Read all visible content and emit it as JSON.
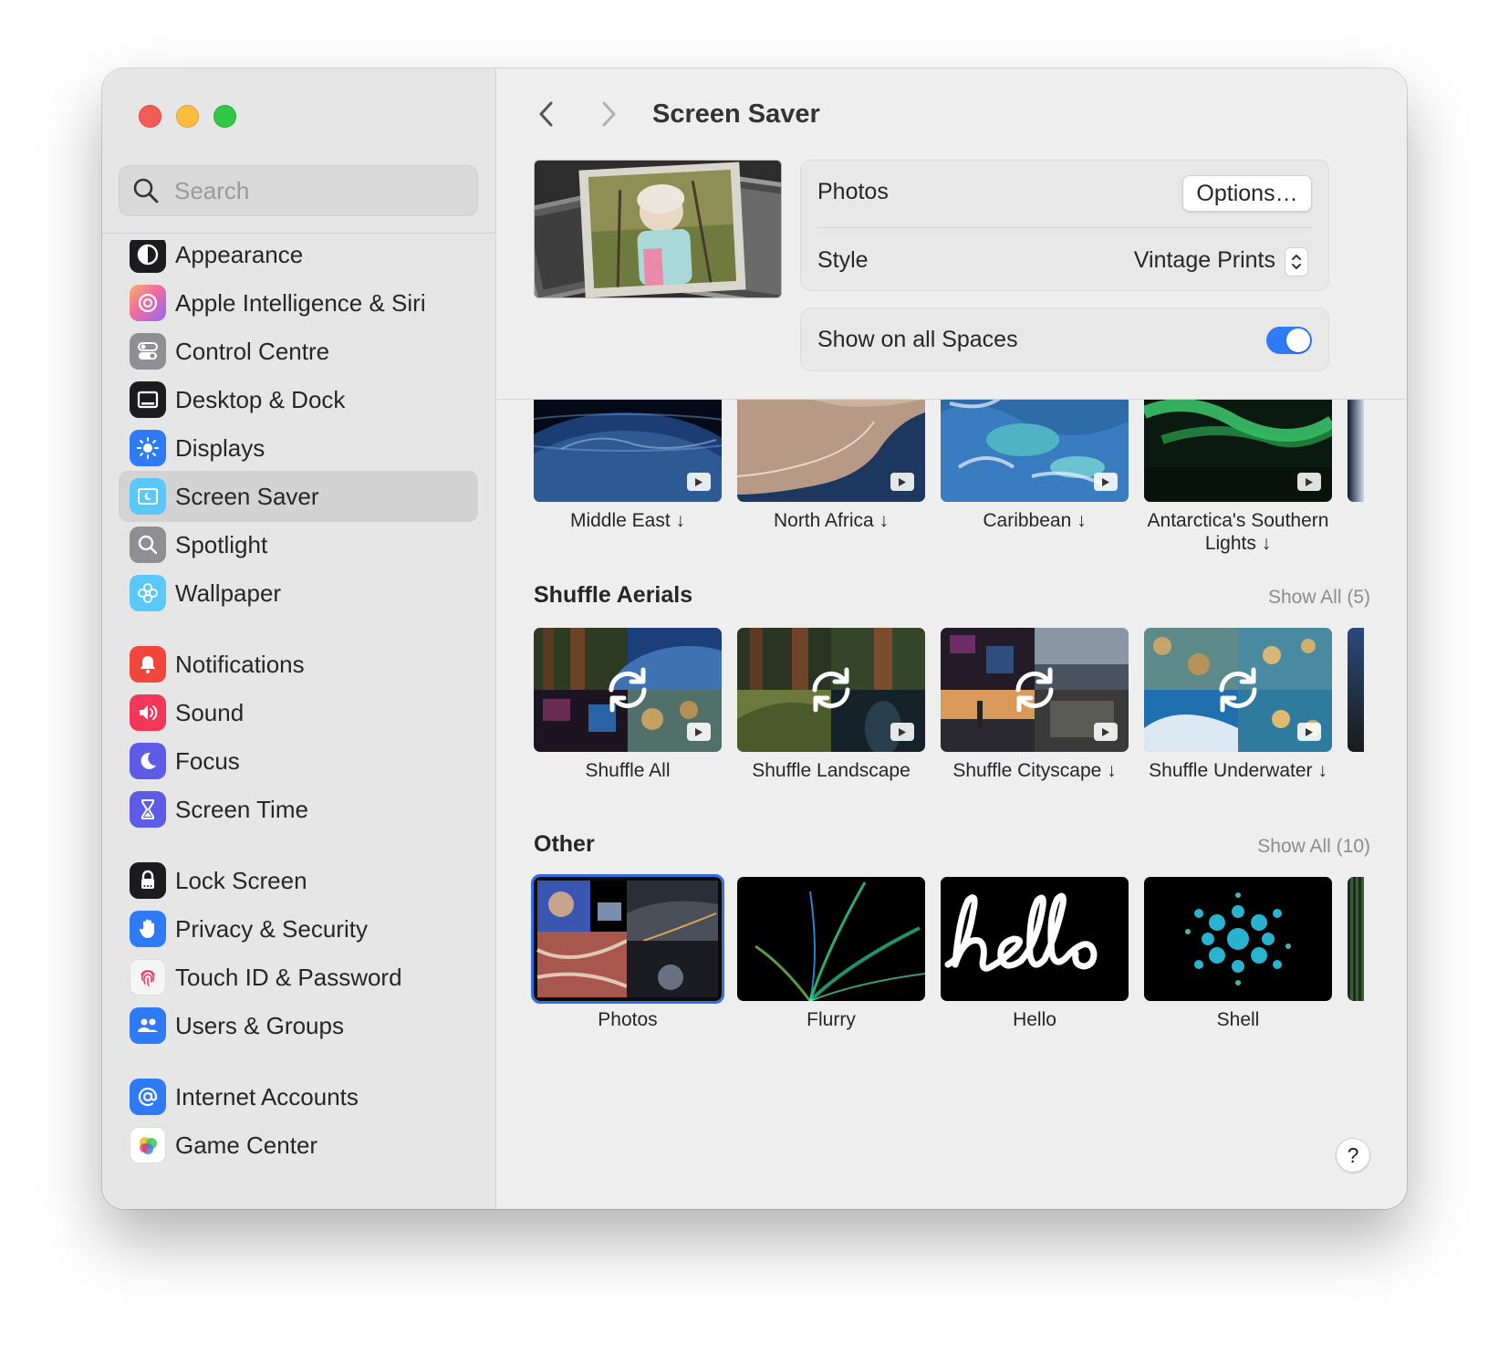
{
  "window": {
    "title": "Screen Saver"
  },
  "sidebar": {
    "search_placeholder": "Search",
    "items": [
      {
        "label": "Appearance",
        "icon": "appearance-icon",
        "color": "#1c1c1e"
      },
      {
        "label": "Apple Intelligence & Siri",
        "icon": "siri-icon",
        "color": "#f0a0d0"
      },
      {
        "label": "Control Centre",
        "icon": "control-centre-icon",
        "color": "#8e8e93"
      },
      {
        "label": "Desktop & Dock",
        "icon": "desktop-dock-icon",
        "color": "#1c1c1e"
      },
      {
        "label": "Displays",
        "icon": "displays-icon",
        "color": "#2f7bf5"
      },
      {
        "label": "Screen Saver",
        "icon": "screen-saver-icon",
        "color": "#5ac8fa",
        "selected": true
      },
      {
        "label": "Spotlight",
        "icon": "spotlight-icon",
        "color": "#8e8e93"
      },
      {
        "label": "Wallpaper",
        "icon": "wallpaper-icon",
        "color": "#5ac8fa"
      },
      {
        "label": "Notifications",
        "icon": "notifications-icon",
        "color": "#f2463b"
      },
      {
        "label": "Sound",
        "icon": "sound-icon",
        "color": "#f2385a"
      },
      {
        "label": "Focus",
        "icon": "focus-icon",
        "color": "#5e5ce6"
      },
      {
        "label": "Screen Time",
        "icon": "screen-time-icon",
        "color": "#5e5ce6"
      },
      {
        "label": "Lock Screen",
        "icon": "lock-screen-icon",
        "color": "#1c1c1e"
      },
      {
        "label": "Privacy & Security",
        "icon": "privacy-hand-icon",
        "color": "#2f7bf5"
      },
      {
        "label": "Touch ID & Password",
        "icon": "fingerprint-icon",
        "color": "#f5f5f5"
      },
      {
        "label": "Users & Groups",
        "icon": "users-icon",
        "color": "#2f7bf5"
      },
      {
        "label": "Internet Accounts",
        "icon": "at-icon",
        "color": "#2f7bf5"
      },
      {
        "label": "Game Center",
        "icon": "game-center-icon",
        "color": "#ffffff"
      }
    ]
  },
  "header": {
    "title": "Screen Saver"
  },
  "settings": {
    "source_label": "Photos",
    "options_label": "Options…",
    "style_label": "Style",
    "style_value": "Vintage Prints",
    "show_all_spaces_label": "Show on all Spaces",
    "show_all_spaces_on": true
  },
  "landscape_row": [
    {
      "label": "Middle East ↓"
    },
    {
      "label": "North Africa ↓"
    },
    {
      "label": "Caribbean ↓"
    },
    {
      "label": "Antarctica's Southern Lights ↓"
    }
  ],
  "shuffle": {
    "title": "Shuffle Aerials",
    "show_all": "Show All (5)",
    "items": [
      {
        "label": "Shuffle All"
      },
      {
        "label": "Shuffle Landscape"
      },
      {
        "label": "Shuffle Cityscape ↓"
      },
      {
        "label": "Shuffle Underwater ↓"
      }
    ]
  },
  "other": {
    "title": "Other",
    "show_all": "Show All (10)",
    "items": [
      {
        "label": "Photos",
        "selected": true
      },
      {
        "label": "Flurry"
      },
      {
        "label": "Hello"
      },
      {
        "label": "Shell"
      }
    ]
  },
  "help_label": "?",
  "colors": {
    "accent": "#2f7bf5",
    "selection": "#2f6fe0"
  }
}
